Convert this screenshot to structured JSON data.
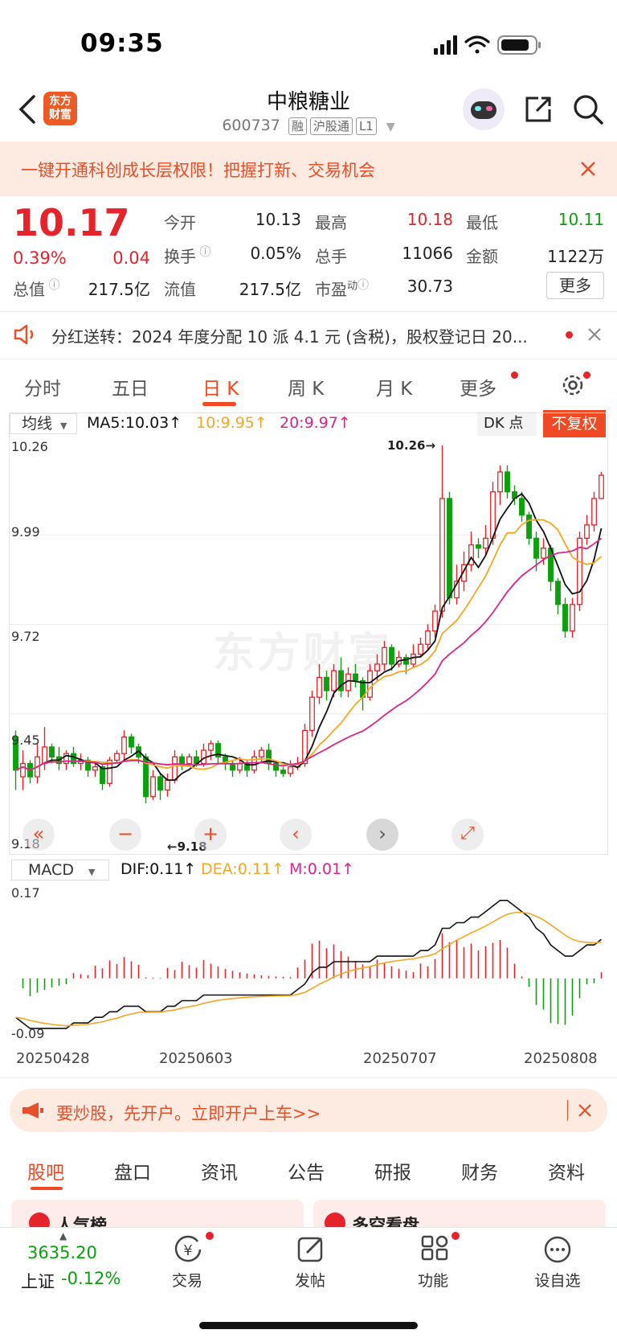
{
  "status": {
    "time": "09:35"
  },
  "header": {
    "name": "中粮糖业",
    "code": "600737",
    "tags": [
      "融",
      "沪股通",
      "L1"
    ],
    "logo_text": "东方财富"
  },
  "promo": {
    "text": "一键开通科创成长层权限！把握打新、交易机会"
  },
  "quote": {
    "price": "10.17",
    "pct": "0.39%",
    "chg": "0.04",
    "open_label": "今开",
    "open": "10.13",
    "high_label": "最高",
    "high": "10.18",
    "low_label": "最低",
    "low": "10.11",
    "turnover_label": "换手",
    "turnover": "0.05%",
    "volume_label": "总手",
    "volume": "11066",
    "amount_label": "金额",
    "amount": "1122万",
    "mktcap_label": "总值",
    "mktcap": "217.5亿",
    "float_label": "流值",
    "float": "217.5亿",
    "pe_label": "市盈",
    "pe_sup": "动",
    "pe": "30.73",
    "more_label": "更多"
  },
  "news": {
    "text": "分红送转：2024 年度分配 10 派 4.1 元 (含税)，股权登记日 20..."
  },
  "period_tabs": [
    "分时",
    "五日",
    "日 K",
    "周 K",
    "月 K",
    "更多"
  ],
  "active_period": "日 K",
  "indicator_bar": {
    "selector": "均线",
    "ma5": "MA5:10.03↑",
    "ma10": "10:9.95↑",
    "ma20": "20:9.97↑",
    "dk": "DK 点",
    "adjust": "不复权"
  },
  "macd_bar": {
    "selector": "MACD",
    "dif": "DIF:0.11↑",
    "dea": "DEA:0.11↑",
    "m": "M:0.01↑"
  },
  "colors": {
    "up": "#e6232b",
    "down": "#0ca10c",
    "ma5": "#111111",
    "ma10": "#f5a623",
    "ma20": "#d8258c",
    "accent": "#f04a24"
  },
  "chart_data": {
    "type": "candlestick",
    "y_ticks": [
      "10.26",
      "9.99",
      "9.72",
      "9.45",
      "9.18"
    ],
    "ylim": [
      9.18,
      10.26
    ],
    "max_label": "10.26→",
    "min_label": "←9.18",
    "x_ticks": [
      "20250428",
      "20250603",
      "20250707",
      "20250808"
    ],
    "macd_ticks": [
      "0.17",
      "-0.09"
    ],
    "candles": [
      [
        9.38,
        9.28,
        9.4,
        9.22
      ],
      [
        9.26,
        9.3,
        9.34,
        9.22
      ],
      [
        9.3,
        9.26,
        9.31,
        9.24
      ],
      [
        9.26,
        9.32,
        9.36,
        9.24
      ],
      [
        9.3,
        9.35,
        9.41,
        9.28
      ],
      [
        9.35,
        9.32,
        9.36,
        9.3
      ],
      [
        9.32,
        9.3,
        9.35,
        9.28
      ],
      [
        9.3,
        9.33,
        9.34,
        9.28
      ],
      [
        9.33,
        9.3,
        9.35,
        9.29
      ],
      [
        9.3,
        9.31,
        9.33,
        9.28
      ],
      [
        9.31,
        9.28,
        9.32,
        9.26
      ],
      [
        9.28,
        9.29,
        9.3,
        9.26
      ],
      [
        9.29,
        9.24,
        9.3,
        9.22
      ],
      [
        9.24,
        9.31,
        9.32,
        9.23
      ],
      [
        9.31,
        9.33,
        9.34,
        9.3
      ],
      [
        9.33,
        9.38,
        9.4,
        9.31
      ],
      [
        9.38,
        9.35,
        9.39,
        9.33
      ],
      [
        9.35,
        9.32,
        9.36,
        9.3
      ],
      [
        9.32,
        9.2,
        9.33,
        9.18
      ],
      [
        9.2,
        9.26,
        9.28,
        9.19
      ],
      [
        9.26,
        9.22,
        9.27,
        9.19
      ],
      [
        9.22,
        9.25,
        9.27,
        9.2
      ],
      [
        9.25,
        9.32,
        9.34,
        9.24
      ],
      [
        9.32,
        9.3,
        9.33,
        9.28
      ],
      [
        9.3,
        9.32,
        9.33,
        9.29
      ],
      [
        9.32,
        9.3,
        9.34,
        9.29
      ],
      [
        9.3,
        9.34,
        9.36,
        9.29
      ],
      [
        9.34,
        9.36,
        9.37,
        9.31
      ],
      [
        9.36,
        9.32,
        9.37,
        9.3
      ],
      [
        9.32,
        9.3,
        9.33,
        9.28
      ],
      [
        9.3,
        9.28,
        9.31,
        9.26
      ],
      [
        9.28,
        9.3,
        9.32,
        9.27
      ],
      [
        9.3,
        9.28,
        9.31,
        9.26
      ],
      [
        9.28,
        9.32,
        9.34,
        9.27
      ],
      [
        9.32,
        9.34,
        9.35,
        9.3
      ],
      [
        9.34,
        9.3,
        9.36,
        9.28
      ],
      [
        9.3,
        9.28,
        9.31,
        9.26
      ],
      [
        9.28,
        9.27,
        9.29,
        9.26
      ],
      [
        9.27,
        9.29,
        9.31,
        9.26
      ],
      [
        9.29,
        9.3,
        9.32,
        9.28
      ],
      [
        9.3,
        9.4,
        9.42,
        9.29
      ],
      [
        9.4,
        9.5,
        9.52,
        9.38
      ],
      [
        9.5,
        9.56,
        9.6,
        9.48
      ],
      [
        9.56,
        9.52,
        9.58,
        9.49
      ],
      [
        9.52,
        9.58,
        9.6,
        9.5
      ],
      [
        9.58,
        9.52,
        9.62,
        9.5
      ],
      [
        9.52,
        9.57,
        9.59,
        9.5
      ],
      [
        9.57,
        9.55,
        9.6,
        9.53
      ],
      [
        9.55,
        9.5,
        9.56,
        9.46
      ],
      [
        9.5,
        9.58,
        9.6,
        9.49
      ],
      [
        9.58,
        9.6,
        9.63,
        9.55
      ],
      [
        9.6,
        9.65,
        9.67,
        9.58
      ],
      [
        9.65,
        9.6,
        9.66,
        9.58
      ],
      [
        9.6,
        9.62,
        9.64,
        9.59
      ],
      [
        9.62,
        9.6,
        9.63,
        9.57
      ],
      [
        9.6,
        9.63,
        9.66,
        9.59
      ],
      [
        9.63,
        9.66,
        9.68,
        9.62
      ],
      [
        9.66,
        9.7,
        9.72,
        9.64
      ],
      [
        9.7,
        9.76,
        9.78,
        9.68
      ],
      [
        9.76,
        10.1,
        10.26,
        9.74
      ],
      [
        10.1,
        9.8,
        10.12,
        9.78
      ],
      [
        9.8,
        9.85,
        9.9,
        9.78
      ],
      [
        9.85,
        9.9,
        9.94,
        9.82
      ],
      [
        9.9,
        9.96,
        10.0,
        9.88
      ],
      [
        9.96,
        9.95,
        9.98,
        9.92
      ],
      [
        9.95,
        9.98,
        10.02,
        9.93
      ],
      [
        9.98,
        10.12,
        10.15,
        9.96
      ],
      [
        10.12,
        10.18,
        10.2,
        10.08
      ],
      [
        10.18,
        10.12,
        10.2,
        10.1
      ],
      [
        10.12,
        10.1,
        10.14,
        10.08
      ],
      [
        10.1,
        10.05,
        10.12,
        10.03
      ],
      [
        10.05,
        9.98,
        10.06,
        9.96
      ],
      [
        9.98,
        9.92,
        10.0,
        9.88
      ],
      [
        9.92,
        9.95,
        9.98,
        9.9
      ],
      [
        9.95,
        9.85,
        9.96,
        9.82
      ],
      [
        9.85,
        9.78,
        9.86,
        9.75
      ],
      [
        9.78,
        9.7,
        9.8,
        9.68
      ],
      [
        9.7,
        9.78,
        9.8,
        9.68
      ],
      [
        9.78,
        9.98,
        10.0,
        9.76
      ],
      [
        9.98,
        10.02,
        10.05,
        9.96
      ],
      [
        10.02,
        10.1,
        10.12,
        10.0
      ],
      [
        10.1,
        10.17,
        10.18,
        10.11
      ]
    ],
    "macd_dif": [
      -0.06,
      -0.07,
      -0.08,
      -0.08,
      -0.08,
      -0.08,
      -0.08,
      -0.08,
      -0.07,
      -0.07,
      -0.07,
      -0.06,
      -0.06,
      -0.05,
      -0.05,
      -0.04,
      -0.04,
      -0.04,
      -0.05,
      -0.05,
      -0.05,
      -0.04,
      -0.04,
      -0.03,
      -0.03,
      -0.03,
      -0.02,
      -0.02,
      -0.02,
      -0.02,
      -0.02,
      -0.02,
      -0.02,
      -0.02,
      -0.02,
      -0.02,
      -0.02,
      -0.02,
      -0.02,
      -0.01,
      0.0,
      0.02,
      0.03,
      0.03,
      0.04,
      0.04,
      0.04,
      0.04,
      0.04,
      0.04,
      0.05,
      0.05,
      0.05,
      0.05,
      0.05,
      0.05,
      0.06,
      0.06,
      0.07,
      0.1,
      0.1,
      0.11,
      0.11,
      0.12,
      0.12,
      0.13,
      0.14,
      0.15,
      0.15,
      0.14,
      0.13,
      0.12,
      0.1,
      0.09,
      0.07,
      0.06,
      0.05,
      0.05,
      0.06,
      0.07,
      0.07,
      0.08
    ]
  },
  "chart_controls": [
    "«",
    "−",
    "+",
    "‹",
    "›",
    "⤢"
  ],
  "open_account": {
    "text": "要炒股，先开户。立即开户上车>>"
  },
  "bottom_tabs": [
    "股吧",
    "盘口",
    "资讯",
    "公告",
    "研报",
    "财务",
    "资料"
  ],
  "peek": {
    "left": "人气榜",
    "right": "多空看盘"
  },
  "index": {
    "value": "3635.20",
    "name": "上证",
    "pct": "-0.12%"
  },
  "nav": [
    "交易",
    "发帖",
    "功能",
    "设自选"
  ]
}
